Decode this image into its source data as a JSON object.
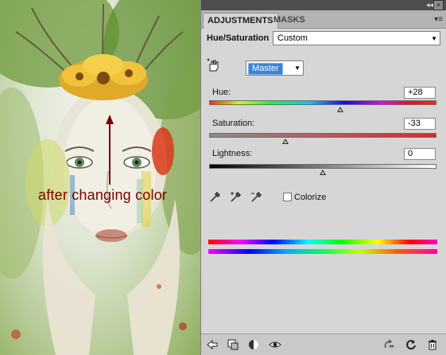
{
  "artwork": {
    "caption": "after changing color"
  },
  "panel": {
    "tabs": [
      {
        "label": "ADJUSTMENTS",
        "active": true
      },
      {
        "label": "MASKS",
        "active": false
      }
    ],
    "adjustment_title": "Hue/Saturation",
    "preset": "Custom",
    "channel": "Master",
    "hue": {
      "label": "Hue:",
      "value": "+28",
      "min": -180,
      "max": 180
    },
    "saturation": {
      "label": "Saturation:",
      "value": "-33",
      "min": -100,
      "max": 100
    },
    "lightness": {
      "label": "Lightness:",
      "value": "0",
      "min": -100,
      "max": 100
    },
    "colorize": {
      "label": "Colorize",
      "checked": false
    },
    "icons": {
      "on_image_adjust": "hand-adjust-icon",
      "eyedroppers": [
        "eyedropper-icon",
        "eyedropper-add-icon",
        "eyedropper-subtract-icon"
      ],
      "bottom": [
        "back-arrow-icon",
        "clip-layer-icon",
        "layer-mask-icon",
        "visibility-eye-icon",
        "view-previous-icon",
        "reset-icon",
        "trash-icon"
      ]
    }
  }
}
